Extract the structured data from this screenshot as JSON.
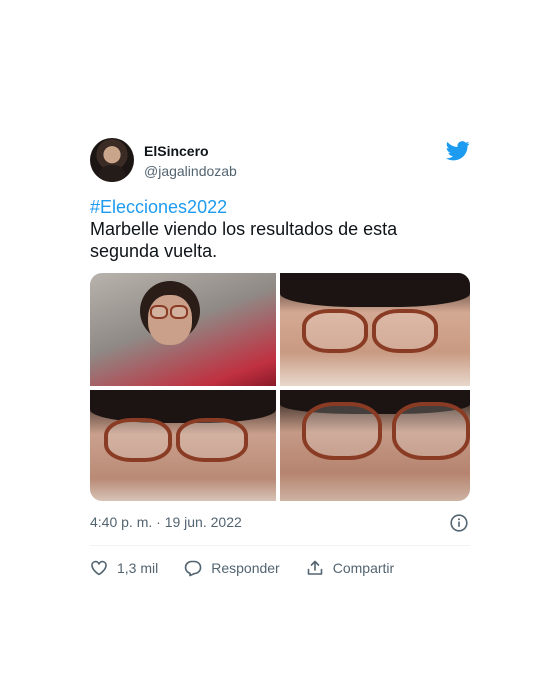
{
  "tweet": {
    "author": {
      "display_name": "ElSincero",
      "handle": "@jagalindozab"
    },
    "hashtag": "#Elecciones2022",
    "body": "Marbelle viendo los resultados de esta segunda vuelta.",
    "timestamp": "4:40 p. m. · 19 jun. 2022",
    "actions": {
      "like_count": "1,3 mil",
      "reply_label": "Responder",
      "share_label": "Compartir"
    }
  },
  "colors": {
    "accent": "#1d9bf0",
    "text": "#0f1419",
    "muted": "#536471"
  },
  "icons": [
    "twitter-bird-icon",
    "info-icon",
    "heart-icon",
    "reply-icon",
    "share-icon"
  ]
}
